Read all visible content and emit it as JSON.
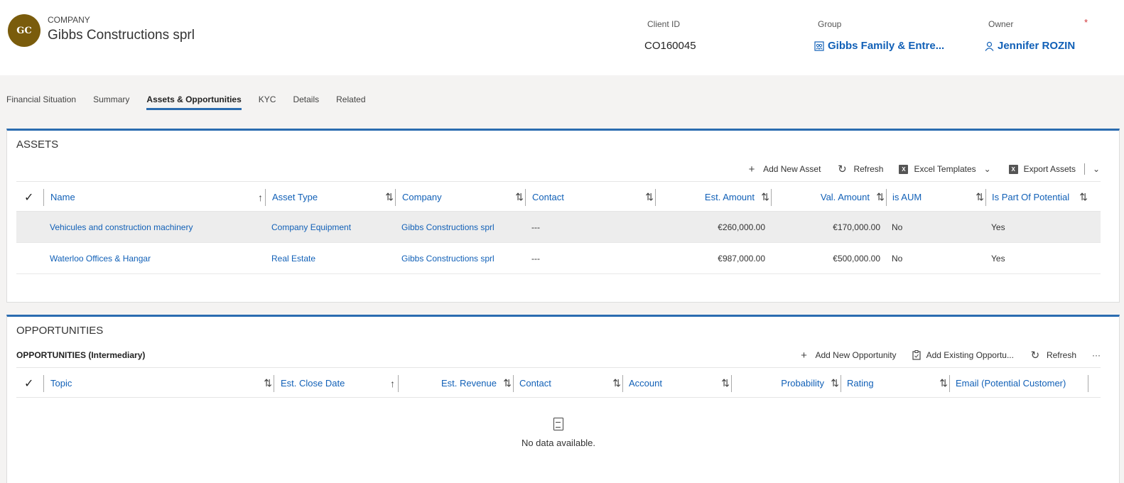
{
  "header": {
    "avatar_initials": "GC",
    "entity_type": "COMPANY",
    "entity_name": "Gibbs Constructions sprl",
    "fields": {
      "client_id": {
        "label": "Client ID",
        "value": "CO160045"
      },
      "group": {
        "label": "Group",
        "value": "Gibbs Family & Entre..."
      },
      "owner": {
        "label": "Owner",
        "value": "Jennifer ROZIN",
        "required_marker": "*"
      }
    }
  },
  "tabs": [
    {
      "label": "Financial Situation"
    },
    {
      "label": "Summary"
    },
    {
      "label": "Assets & Opportunities",
      "active": true
    },
    {
      "label": "KYC"
    },
    {
      "label": "Details"
    },
    {
      "label": "Related"
    }
  ],
  "assets": {
    "title": "ASSETS",
    "commands": {
      "add": "Add New Asset",
      "refresh": "Refresh",
      "excel": "Excel Templates",
      "export": "Export Assets"
    },
    "columns": {
      "name": "Name",
      "asset_type": "Asset Type",
      "company": "Company",
      "contact": "Contact",
      "est_amount": "Est. Amount",
      "val_amount": "Val. Amount",
      "is_aum": "is AUM",
      "is_part": "Is Part Of Potential"
    },
    "rows": [
      {
        "name": "Vehicules and construction machinery",
        "asset_type": "Company Equipment",
        "company": "Gibbs Constructions sprl",
        "contact": "---",
        "est_amount": "€260,000.00",
        "val_amount": "€170,000.00",
        "is_aum": "No",
        "is_part": "Yes"
      },
      {
        "name": "Waterloo Offices & Hangar",
        "asset_type": "Real Estate",
        "company": "Gibbs Constructions sprl",
        "contact": "---",
        "est_amount": "€987,000.00",
        "val_amount": "€500,000.00",
        "is_aum": "No",
        "is_part": "Yes"
      }
    ]
  },
  "opportunities": {
    "title": "OPPORTUNITIES",
    "subtitle": "OPPORTUNITIES (Intermediary)",
    "commands": {
      "add": "Add New Opportunity",
      "add_existing": "Add Existing Opportu...",
      "refresh": "Refresh",
      "more": "···"
    },
    "columns": {
      "topic": "Topic",
      "close_date": "Est. Close Date",
      "revenue": "Est. Revenue",
      "contact": "Contact",
      "account": "Account",
      "probability": "Probability",
      "rating": "Rating",
      "email": "Email (Potential Customer)"
    },
    "empty_text": "No data available."
  },
  "colors": {
    "accent": "#2b6cb0",
    "link": "#1160b7",
    "avatar": "#7a5c0c"
  }
}
